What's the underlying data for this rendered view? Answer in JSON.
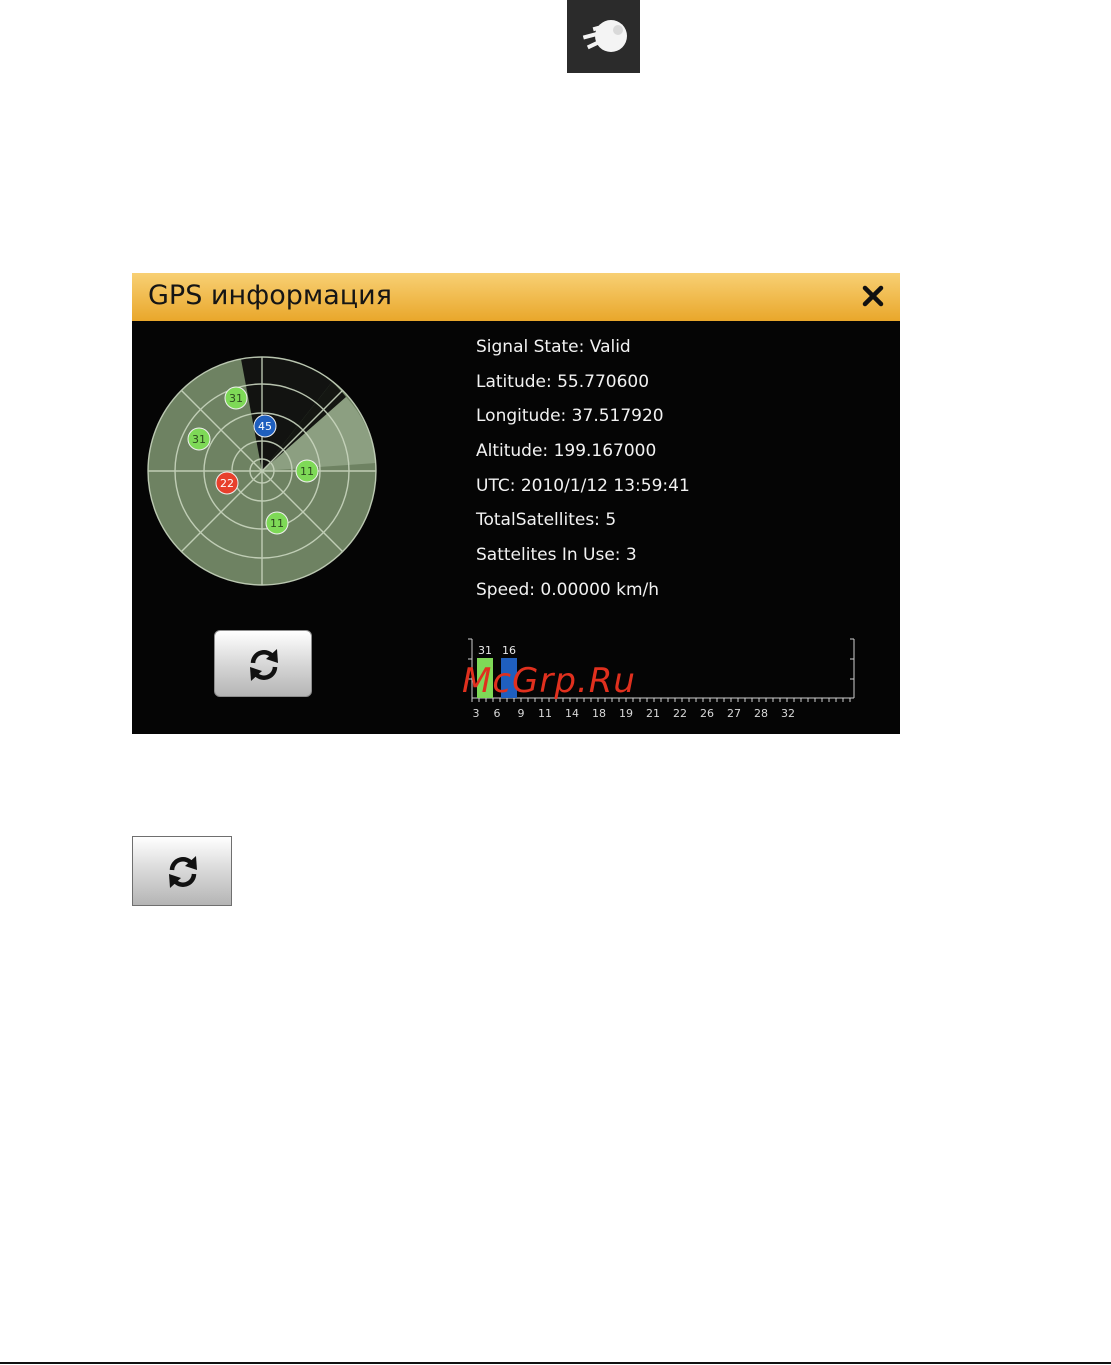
{
  "dialog": {
    "title": "GPS информация",
    "info": [
      "Signal State: Valid",
      "Latitude: 55.770600",
      "Longitude: 37.517920",
      "Altitude: 199.167000",
      "UTC: 2010/1/12 13:59:41",
      "TotalSatellites: 5",
      "Sattelites In Use: 3",
      "Speed: 0.00000 km/h"
    ]
  },
  "radar": {
    "satellites": [
      {
        "label": "31",
        "status": "in-use",
        "color": "#7ed957"
      },
      {
        "label": "31",
        "status": "in-use",
        "color": "#7ed957"
      },
      {
        "label": "45",
        "status": "tracked",
        "color": "#1f5fbf"
      },
      {
        "label": "11",
        "status": "in-use",
        "color": "#7ed957"
      },
      {
        "label": "22",
        "status": "no-fix",
        "color": "#e8402c"
      },
      {
        "label": "11",
        "status": "in-use",
        "color": "#7ed957"
      }
    ]
  },
  "snr": {
    "bars": [
      {
        "label": "31",
        "color": "#7ed957"
      },
      {
        "label": "16",
        "color": "#1f5fbf"
      }
    ],
    "x_labels": [
      "3",
      "6",
      "9",
      "11",
      "14",
      "18",
      "19",
      "21",
      "22",
      "26",
      "27",
      "28",
      "32"
    ]
  },
  "watermark": "McGrp.Ru",
  "colors": {
    "titlebar": "#f0b84a",
    "dialog_bg": "#050505",
    "radar": "#7a8f6c",
    "in_use": "#7ed957",
    "tracked": "#1f5fbf",
    "no_fix": "#e8402c"
  },
  "icons": [
    "satellite-icon",
    "close-icon",
    "refresh-icon"
  ]
}
